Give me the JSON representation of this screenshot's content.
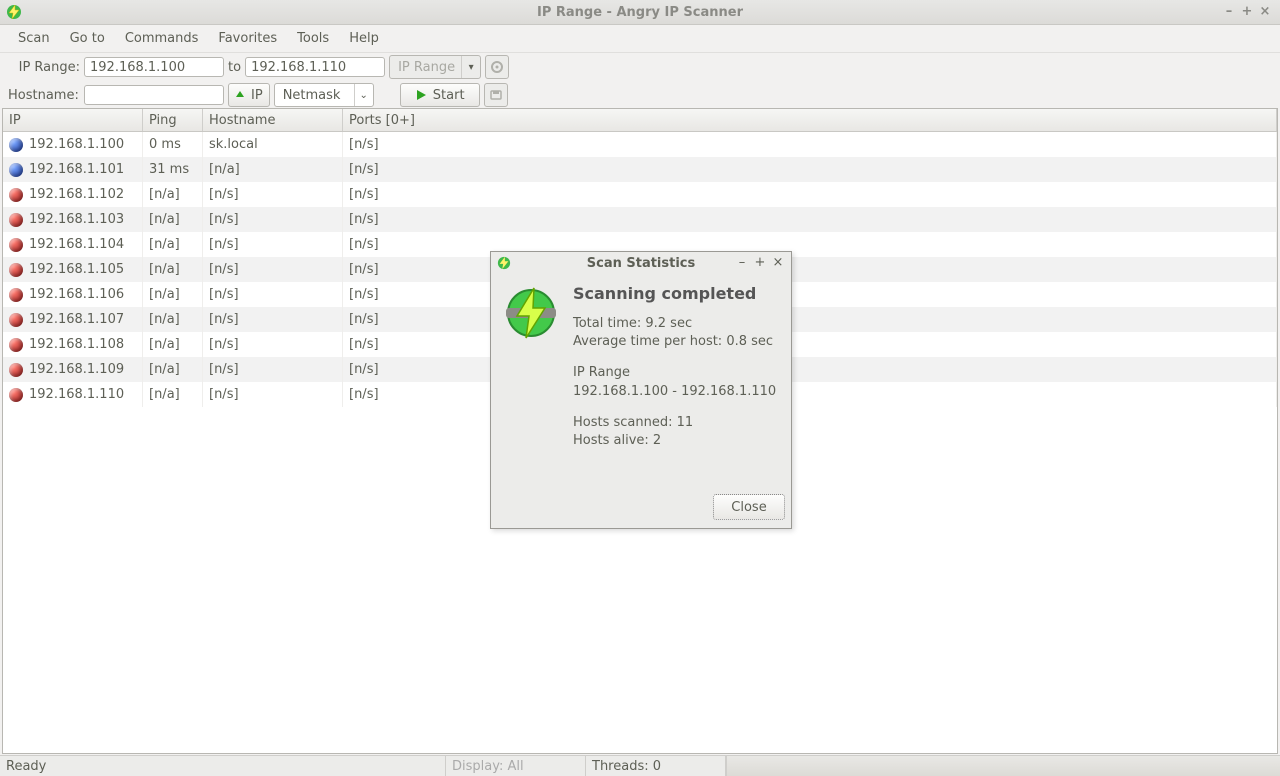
{
  "window": {
    "title": "IP Range - Angry IP Scanner",
    "minimize": "–",
    "maximize": "+",
    "close": "×"
  },
  "menu": [
    "Scan",
    "Go to",
    "Commands",
    "Favorites",
    "Tools",
    "Help"
  ],
  "toolbar1": {
    "range_label": "IP Range:",
    "from": "192.168.1.100",
    "to_label": "to",
    "to": "192.168.1.110",
    "range_btn": "IP Range",
    "prefs_tip": "prefs"
  },
  "toolbar2": {
    "hostname_label": "Hostname:",
    "hostname": "",
    "ip_btn": "IP",
    "netmask": "Netmask",
    "start": "Start"
  },
  "columns": {
    "ip": "IP",
    "ping": "Ping",
    "hostname": "Hostname",
    "ports": "Ports [0+]"
  },
  "rows": [
    {
      "status": "blue",
      "ip": "192.168.1.100",
      "ping": "0 ms",
      "hostname": "sk.local",
      "ports": "[n/s]"
    },
    {
      "status": "blue",
      "ip": "192.168.1.101",
      "ping": "31 ms",
      "hostname": "[n/a]",
      "ports": "[n/s]"
    },
    {
      "status": "red",
      "ip": "192.168.1.102",
      "ping": "[n/a]",
      "hostname": "[n/s]",
      "ports": "[n/s]"
    },
    {
      "status": "red",
      "ip": "192.168.1.103",
      "ping": "[n/a]",
      "hostname": "[n/s]",
      "ports": "[n/s]"
    },
    {
      "status": "red",
      "ip": "192.168.1.104",
      "ping": "[n/a]",
      "hostname": "[n/s]",
      "ports": "[n/s]"
    },
    {
      "status": "red",
      "ip": "192.168.1.105",
      "ping": "[n/a]",
      "hostname": "[n/s]",
      "ports": "[n/s]"
    },
    {
      "status": "red",
      "ip": "192.168.1.106",
      "ping": "[n/a]",
      "hostname": "[n/s]",
      "ports": "[n/s]"
    },
    {
      "status": "red",
      "ip": "192.168.1.107",
      "ping": "[n/a]",
      "hostname": "[n/s]",
      "ports": "[n/s]"
    },
    {
      "status": "red",
      "ip": "192.168.1.108",
      "ping": "[n/a]",
      "hostname": "[n/s]",
      "ports": "[n/s]"
    },
    {
      "status": "red",
      "ip": "192.168.1.109",
      "ping": "[n/a]",
      "hostname": "[n/s]",
      "ports": "[n/s]"
    },
    {
      "status": "red",
      "ip": "192.168.1.110",
      "ping": "[n/a]",
      "hostname": "[n/s]",
      "ports": "[n/s]"
    }
  ],
  "status": {
    "ready": "Ready",
    "display": "Display: All",
    "threads": "Threads: 0"
  },
  "dialog": {
    "title": "Scan Statistics",
    "heading": "Scanning completed",
    "total_time": "Total time: 9.2 sec",
    "avg_time": "Average time per host: 0.8 sec",
    "range_label": "IP Range",
    "range": "192.168.1.100 - 192.168.1.110",
    "scanned": "Hosts scanned: 11",
    "alive": "Hosts alive: 2",
    "close": "Close",
    "minimize": "–",
    "maximize": "+",
    "x": "×"
  }
}
